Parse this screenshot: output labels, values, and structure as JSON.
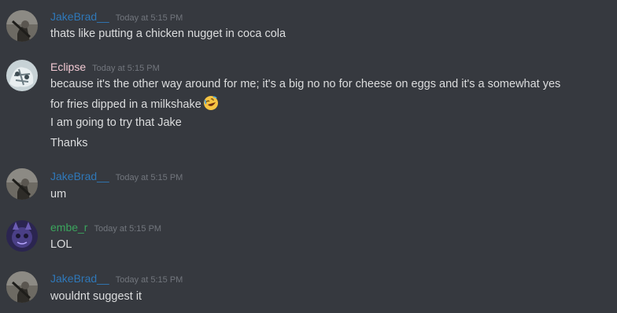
{
  "colors": {
    "background": "#36393f",
    "text": "#dcddde",
    "timestamp": "#72767d",
    "jake": "#2f78b9",
    "eclipse": "#f2c9d3",
    "embe": "#3ba55d"
  },
  "messages": [
    {
      "username": "JakeBrad__",
      "timestamp": "Today at 5:15 PM",
      "lines": [
        "thats like putting a chicken nugget in coca cola"
      ]
    },
    {
      "username": "Eclipse",
      "timestamp": "Today at 5:15 PM",
      "lines": [
        "because it's the other way around for me; it's a big no no for cheese on eggs and it's a somewhat yes",
        "for fries dipped in a milkshake",
        "I am going to try that Jake",
        "Thanks"
      ],
      "emoji": "rofl-emoji"
    },
    {
      "username": "JakeBrad__",
      "timestamp": "Today at 5:15 PM",
      "lines": [
        "um"
      ]
    },
    {
      "username": "embe_r",
      "timestamp": "Today at 5:15 PM",
      "lines": [
        "LOL"
      ]
    },
    {
      "username": "JakeBrad__",
      "timestamp": "Today at 5:15 PM",
      "lines": [
        "wouldnt suggest it"
      ]
    }
  ]
}
